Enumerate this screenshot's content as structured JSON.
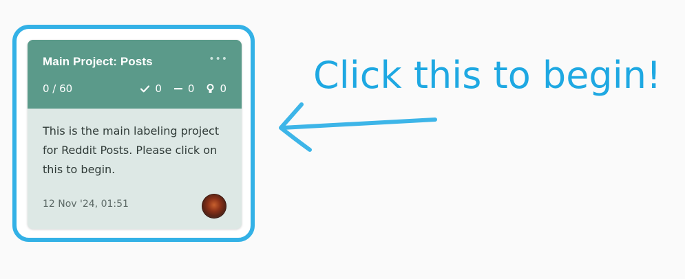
{
  "project_card": {
    "title": "Main Project: Posts",
    "menu_label": "•••",
    "progress": "0 / 60",
    "stats": {
      "completed": "0",
      "skipped": "0",
      "predictions": "0"
    },
    "description": "This is the main labeling project for Reddit Posts. Please click on this to begin.",
    "date": "12 Nov '24, 01:51"
  },
  "annotation": {
    "text": "Click this to begin!",
    "color": "#1ea8e2"
  },
  "colors": {
    "header": "#5b9a8a",
    "card_body": "#dde8e5",
    "highlight": "#33b1e6"
  },
  "icons": [
    "check-icon",
    "minus-icon",
    "lightbulb-icon",
    "more-icon",
    "avatar",
    "arrow-icon"
  ]
}
